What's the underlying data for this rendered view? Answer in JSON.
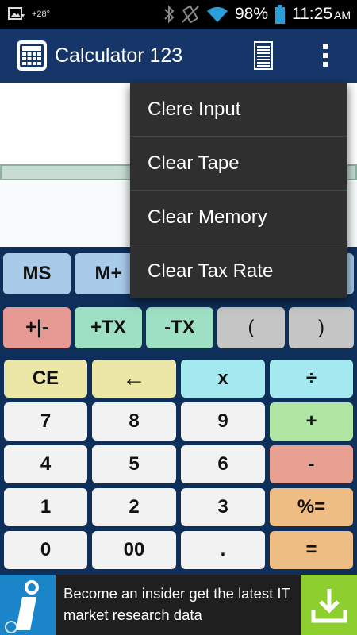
{
  "status_bar": {
    "temperature": "+28°",
    "battery_percent": "98%",
    "time": "11:25",
    "ampm": "AM",
    "icons": [
      "image-notification-icon",
      "bluetooth-icon",
      "vibrate-icon",
      "wifi-icon",
      "battery-icon"
    ]
  },
  "app_bar": {
    "title": "Calculator 123",
    "icons": [
      "calculator-app-icon",
      "tape-icon",
      "overflow-menu-icon"
    ]
  },
  "menu": {
    "items": [
      "Clere Input",
      "Clear Tape",
      "Clear Memory",
      "Clear Tax Rate"
    ]
  },
  "keypad": {
    "memory_row": [
      "MS",
      "M+"
    ],
    "function_row": [
      "+|-",
      "+TX",
      "-TX",
      "(",
      ")"
    ],
    "rows": [
      [
        "CE",
        "←",
        "x",
        "÷"
      ],
      [
        "7",
        "8",
        "9",
        "+"
      ],
      [
        "4",
        "5",
        "6",
        "-"
      ],
      [
        "1",
        "2",
        "3",
        "%="
      ],
      [
        "0",
        "00",
        ".",
        "="
      ]
    ]
  },
  "ad": {
    "text": "Become an insider get the latest IT market research data",
    "icons": [
      "info-logo-icon",
      "download-icon"
    ]
  },
  "colors": {
    "app_bar": "#16366a",
    "keypad_bg": "#0e2f5a",
    "menu_bg": "#2f2f2f",
    "ad_download": "#8ccf2e"
  }
}
